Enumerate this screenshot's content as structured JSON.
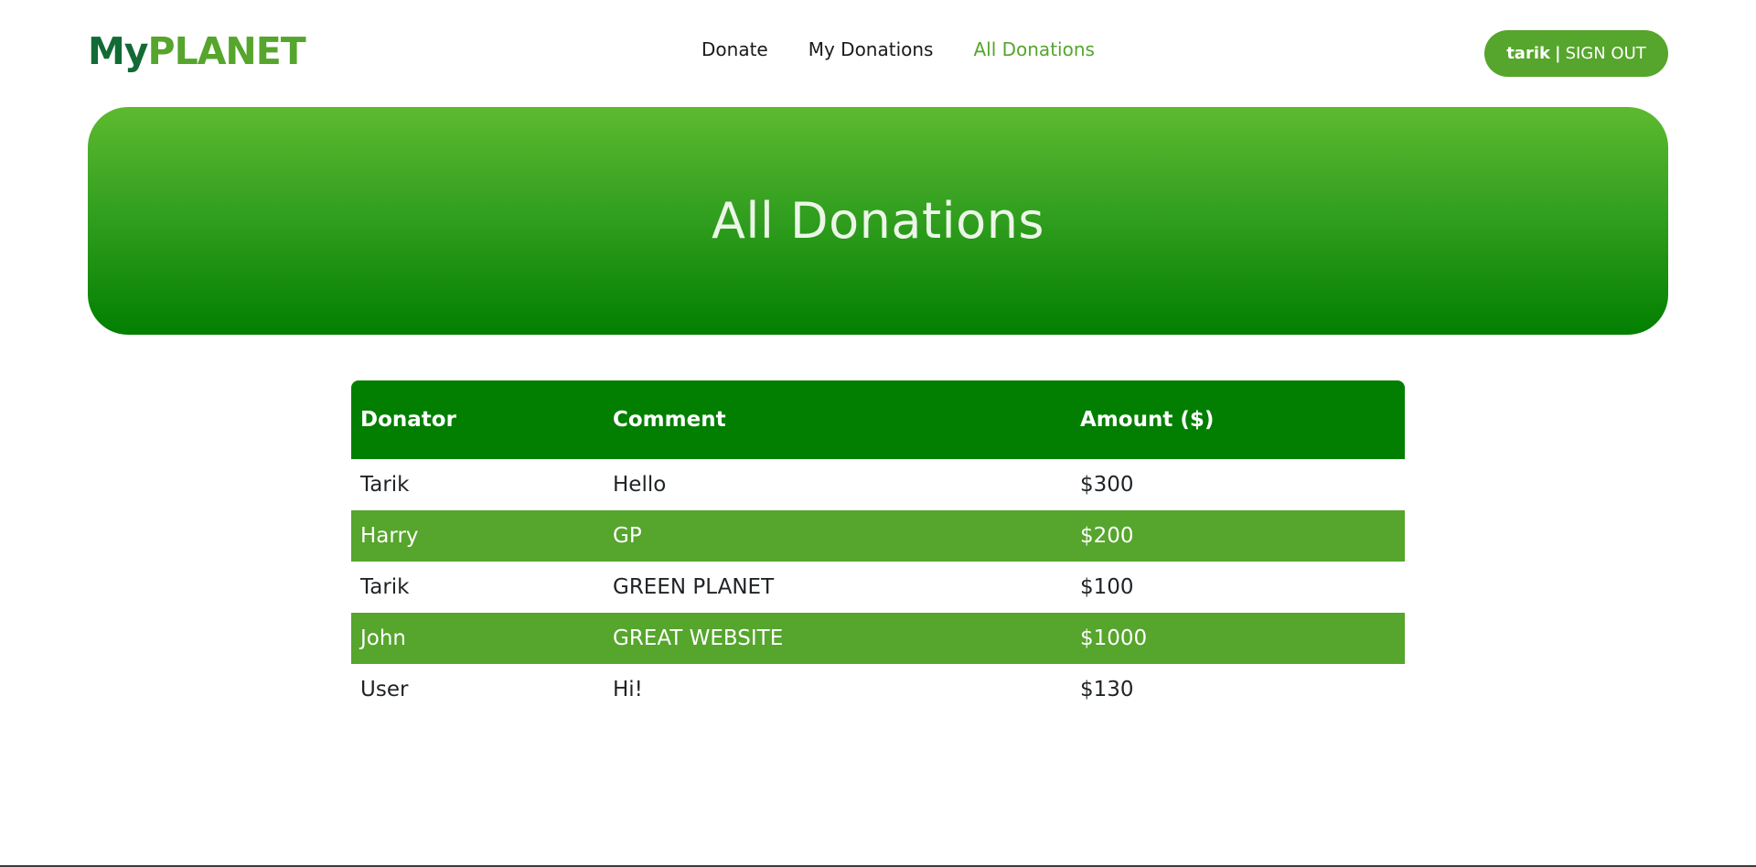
{
  "logo": {
    "part1": "My",
    "part2": "PLANET"
  },
  "nav": {
    "items": [
      {
        "label": "Donate"
      },
      {
        "label": "My Donations"
      },
      {
        "label": "All Donations"
      }
    ],
    "active": "All Donations"
  },
  "user": {
    "name": "tarik",
    "separator": "|",
    "action": "SIGN OUT"
  },
  "hero": {
    "title": "All Donations"
  },
  "table": {
    "columns": [
      "Donator",
      "Comment",
      "Amount ($)"
    ],
    "rows": [
      [
        "Tarik",
        "Hello",
        "$300"
      ],
      [
        "Harry",
        "GP",
        "$200"
      ],
      [
        "Tarik",
        "GREEN PLANET",
        "$100"
      ],
      [
        "John",
        "GREAT WEBSITE",
        "$1000"
      ],
      [
        "User",
        "Hi!",
        "$130"
      ]
    ]
  },
  "colors": {
    "brand_green": "#56a52c",
    "dark_green": "#027f01",
    "logo_dark": "#126b35"
  }
}
